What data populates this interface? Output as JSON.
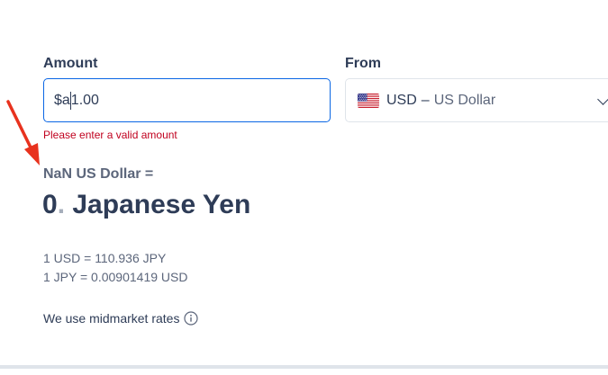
{
  "converter": {
    "amount_label": "Amount",
    "amount_value_prefix": "$a",
    "amount_value_suffix": "1.00",
    "amount_error": "Please enter a valid amount",
    "from_label": "From",
    "from_currency_code": "USD",
    "from_currency_dash": "–",
    "from_currency_name": "US Dollar",
    "from_flag": "us-flag-icon"
  },
  "result": {
    "from_text": "NaN US Dollar =",
    "to_number": "0",
    "to_decimal_sep": ".",
    "to_currency": "Japanese Yen"
  },
  "rates": {
    "line1": "1 USD = 110.936 JPY",
    "line2": "1 JPY = 0.00901419 USD"
  },
  "footer": {
    "midmarket_text": "We use midmarket rates",
    "info_icon": "info-icon"
  },
  "colors": {
    "input_focus_border": "#0a66e4",
    "error": "#c0001e",
    "heading": "#2e3c57",
    "muted": "#5c667b",
    "annotation_arrow": "#e8321e"
  }
}
